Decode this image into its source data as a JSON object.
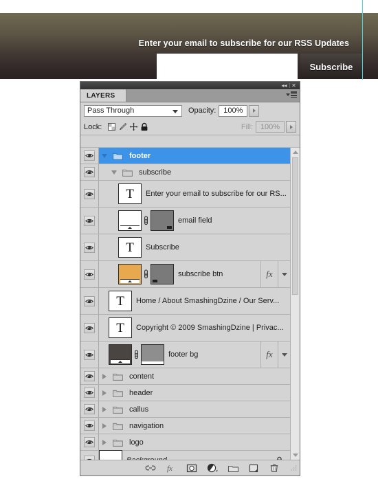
{
  "banner": {
    "title": "Enter your email to subscribe for our RSS Updates",
    "email_placeholder": "",
    "email_value": "",
    "subscribe_label": "Subscribe",
    "bg_top_color": "#6f6a51",
    "bg_bottom_color": "#2b2323",
    "guide_color": "#3fd9e0"
  },
  "panel": {
    "titlebar": {
      "collapse_icon": "collapse-to-icons",
      "close_icon": "close"
    },
    "tab_label": "LAYERS",
    "menu_icon": "panel-menu",
    "blend": {
      "label": "",
      "value": "Pass Through"
    },
    "opacity": {
      "label": "Opacity:",
      "value": "100%"
    },
    "lock": {
      "label": "Lock:",
      "icons": [
        "lock-transparent-pixels",
        "lock-image-pixels",
        "lock-position",
        "lock-all"
      ]
    },
    "fill": {
      "label": "Fill:",
      "value": "100%"
    },
    "selection_color": "#3c93e8",
    "background_color": "#d4d4d4"
  },
  "layers": [
    {
      "name": "footer",
      "kind": "group",
      "indent": 0,
      "expanded": true,
      "selected": true,
      "visible": true,
      "thumb": "none",
      "fx": false,
      "locked": false
    },
    {
      "name": "subscribe",
      "kind": "group",
      "indent": 1,
      "expanded": true,
      "selected": false,
      "visible": true,
      "thumb": "none",
      "fx": false,
      "locked": false
    },
    {
      "name": "Enter your email to subscribe for our RS...",
      "kind": "text",
      "indent": 2,
      "selected": false,
      "visible": true,
      "thumb": "text",
      "thumb_glyph": "T",
      "fx": false,
      "locked": false
    },
    {
      "name": "email field",
      "kind": "shape",
      "indent": 2,
      "selected": false,
      "visible": true,
      "thumb": "fill-mask",
      "thumb_color": "#ffffff",
      "mask_color": "#7a7a7a",
      "fx": false,
      "locked": false
    },
    {
      "name": "Subscribe",
      "kind": "text",
      "indent": 2,
      "selected": false,
      "visible": true,
      "thumb": "text",
      "thumb_glyph": "T",
      "fx": false,
      "locked": false
    },
    {
      "name": "subscribe btn",
      "kind": "shape",
      "indent": 2,
      "selected": false,
      "visible": true,
      "thumb": "fill-mask",
      "thumb_color": "#e8a84e",
      "mask_color": "#7a7a7a",
      "fx": true,
      "fx_label": "fx",
      "locked": false
    },
    {
      "name": "Home  /  About SmashingDzine  /  Our Serv...",
      "kind": "text",
      "indent": 1,
      "selected": false,
      "visible": true,
      "thumb": "text",
      "thumb_glyph": "T",
      "fx": false,
      "locked": false
    },
    {
      "name": "Copyright © 2009 SmashingDzine  |  Privac...",
      "kind": "text",
      "indent": 1,
      "selected": false,
      "visible": true,
      "thumb": "text",
      "thumb_glyph": "T",
      "fx": false,
      "locked": false
    },
    {
      "name": "footer bg",
      "kind": "shape",
      "indent": 1,
      "selected": false,
      "visible": true,
      "thumb": "fill-mask",
      "thumb_color": "#4b4542",
      "mask_color": "#8e8e8e",
      "fx": true,
      "fx_label": "fx",
      "locked": false
    },
    {
      "name": "content",
      "kind": "group",
      "indent": 0,
      "expanded": false,
      "selected": false,
      "visible": true,
      "thumb": "none",
      "fx": false,
      "locked": false
    },
    {
      "name": "header",
      "kind": "group",
      "indent": 0,
      "expanded": false,
      "selected": false,
      "visible": true,
      "thumb": "none",
      "fx": false,
      "locked": false
    },
    {
      "name": "callus",
      "kind": "group",
      "indent": 0,
      "expanded": false,
      "selected": false,
      "visible": true,
      "thumb": "none",
      "fx": false,
      "locked": false
    },
    {
      "name": "navigation",
      "kind": "group",
      "indent": 0,
      "expanded": false,
      "selected": false,
      "visible": true,
      "thumb": "none",
      "fx": false,
      "locked": false
    },
    {
      "name": "logo",
      "kind": "group",
      "indent": 0,
      "expanded": false,
      "selected": false,
      "visible": true,
      "thumb": "none",
      "fx": false,
      "locked": false
    },
    {
      "name": "Background",
      "kind": "background",
      "indent": 0,
      "selected": false,
      "visible": true,
      "thumb": "plain",
      "thumb_color": "#ffffff",
      "fx": false,
      "locked": true,
      "italic": true
    }
  ],
  "footer_tools": [
    {
      "name": "link-layers-icon",
      "title": "Link layers"
    },
    {
      "name": "add-layer-style-icon",
      "title": "Add a layer style"
    },
    {
      "name": "add-layer-mask-icon",
      "title": "Add layer mask"
    },
    {
      "name": "new-adjustment-layer-icon",
      "title": "Create new fill or adjustment layer"
    },
    {
      "name": "new-group-icon",
      "title": "Create a new group"
    },
    {
      "name": "new-layer-icon",
      "title": "Create a new layer"
    },
    {
      "name": "delete-layer-icon",
      "title": "Delete layer"
    }
  ]
}
